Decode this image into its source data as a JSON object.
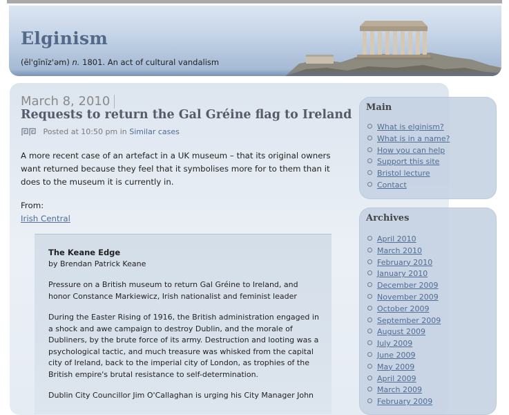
{
  "site": {
    "title": "Elginism",
    "tagline_phonetic": "(ĕl'gĭnĭz'əm)",
    "tagline_pos": "n.",
    "tagline_rest": "1801. An act of cultural vandalism"
  },
  "post": {
    "date": "March 8, 2010",
    "title": "Requests to return the Gal Gréine flag to Ireland",
    "meta_prefix": "Posted at 10:50 pm in",
    "category": "Similar cases",
    "intro": "A more recent case of an artefact in a UK museum – that its original owners want returned because they feel that it symbolises more for to them than it does to the museum it is currently in.",
    "from_label": "From:",
    "from_link": "Irish Central"
  },
  "quote": {
    "title": "The Keane Edge",
    "author": "by Brendan Patrick Keane",
    "paragraphs": [
      "Pressure on a British museum to return Gal Gréine to Ireland, and honor Constance Markiewicz, Irish nationalist and feminist leader",
      "During the Easter Rising of 1916, the British administration engaged in a shock and awe campaign to destroy Dublin, and the morale of Dubliners, by the brute force of its army. Destruction and looting was a psychological tactic, and much treasure was whisked from the capital city of Ireland, back to the imperial city of London, as trophies of the British empire's brutal resistance to self-determination.",
      "Dublin City Councillor Jim O'Callaghan is urging his City Manager John"
    ]
  },
  "sidebar": {
    "main": {
      "title": "Main",
      "items": [
        "What is elginism?",
        "What is in a name?",
        "How you can help",
        "Support this site",
        "Bristol lecture",
        "Contact"
      ]
    },
    "archives": {
      "title": "Archives",
      "items": [
        "April 2010",
        "March 2010",
        "February 2010",
        "January 2010",
        "December 2009",
        "November 2009",
        "October 2009",
        "September 2009",
        "August 2009",
        "July 2009",
        "June 2009",
        "May 2009",
        "April 2009",
        "March 2009",
        "February 2009"
      ]
    }
  },
  "icons": {
    "category": "greek-key-icon",
    "header_image": "parthenon-image"
  },
  "colors": {
    "link": "#4e6c95",
    "site_title": "#54688a",
    "post_title": "#555b69"
  }
}
